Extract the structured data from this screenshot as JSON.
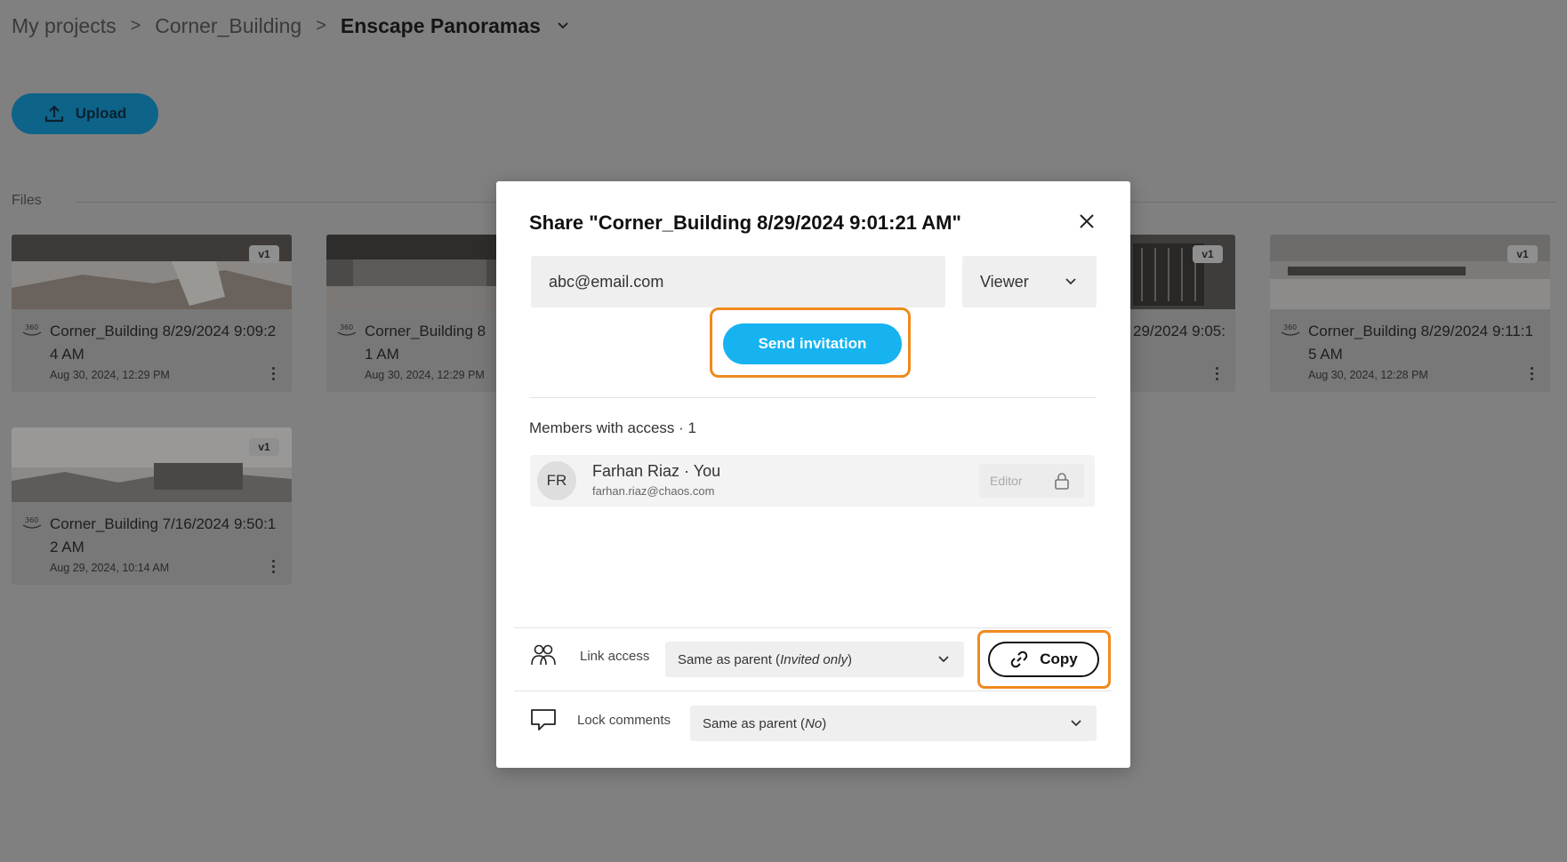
{
  "breadcrumb": {
    "items": [
      "My projects",
      "Corner_Building",
      "Enscape Panoramas"
    ],
    "separator": ">"
  },
  "toolbar": {
    "upload_label": "Upload"
  },
  "files": {
    "section_label": "Files",
    "cards": [
      {
        "name": "Corner_Building 8/29/2024 9:09:24 AM",
        "date": "Aug 30, 2024, 12:29 PM",
        "version": "v1",
        "badge": "360"
      },
      {
        "name": "Corner_Building 8/29/2024 9:0?:?1 AM",
        "name_visible": "Corner_Building 8",
        "name_visible_2": "1 AM",
        "date": "Aug 30, 2024, 12:29 PM",
        "version": "v1",
        "badge": "360"
      },
      {
        "name_visible": "29/2024 9:05:",
        "date": "",
        "version": "v1",
        "badge": "360"
      },
      {
        "name": "Corner_Building 8/29/2024 9:11:15 AM",
        "date": "Aug 30, 2024, 12:28 PM",
        "version": "v1",
        "badge": "360"
      },
      {
        "name": "Corner_Building 7/16/2024 9:50:12 AM",
        "date": "Aug 29, 2024, 10:14 AM",
        "version": "v1",
        "badge": "360"
      }
    ]
  },
  "modal": {
    "title": "Share \"Corner_Building 8/29/2024 9:01:21 AM\"",
    "email_value": "abc@email.com",
    "role_value": "Viewer",
    "send_label": "Send invitation",
    "members_title": "Members with access · 1",
    "member": {
      "initials": "FR",
      "name": "Farhan Riaz · You",
      "email": "farhan.riaz@chaos.com",
      "role": "Editor"
    },
    "link_access_label": "Link access",
    "link_access_value_prefix": "Same as parent (",
    "link_access_value_em": "Invited only",
    "link_access_value_suffix": ")",
    "copy_label": "Copy",
    "lock_comments_label": "Lock comments",
    "lock_comments_value_prefix": "Same as parent (",
    "lock_comments_value_em": "No",
    "lock_comments_value_suffix": ")"
  },
  "colors": {
    "accent": "#16b3f0",
    "highlight": "#f08a1e",
    "overlay_bg": "#808080"
  },
  "icons": [
    "chevron-down-icon",
    "upload-icon",
    "panorama-360-icon",
    "more-vertical-icon",
    "close-icon",
    "lock-icon",
    "people-icon",
    "link-icon",
    "comment-icon"
  ]
}
